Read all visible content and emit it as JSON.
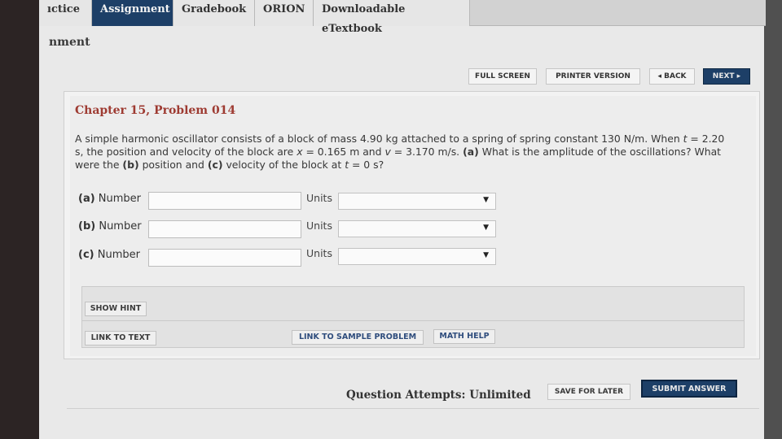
{
  "tabs": [
    {
      "label": "ıctice"
    },
    {
      "label": "Assignment"
    },
    {
      "label": "Gradebook"
    },
    {
      "label": "ORION"
    },
    {
      "label": "Downloadable eTextbook"
    }
  ],
  "section_title": "nment",
  "toolbar": {
    "full_screen": "FULL SCREEN",
    "printer_version": "PRINTER VERSION",
    "back": "◂ BACK",
    "next": "NEXT ▸"
  },
  "problem": {
    "title": "Chapter 15, Problem 014",
    "text_1": "A simple harmonic oscillator consists of a block of mass 4.90 kg attached to a spring of spring constant 130 N/m. When ",
    "text_t": "t",
    "text_2": " = 2.20 s, the position and velocity of the block are ",
    "text_x": "x",
    "text_3": " = 0.165 m and ",
    "text_v": "v",
    "text_4": " = 3.170 m/s. ",
    "part_a": "(a)",
    "text_5": " What is the amplitude of the oscillations? What were the ",
    "part_b": "(b)",
    "text_6": " position and ",
    "part_c": "(c)",
    "text_7": " velocity of the block at ",
    "text_t2": "t",
    "text_8": " = 0 s?"
  },
  "rows": [
    {
      "part": "(a)",
      "label": "Number",
      "units_label": "Units",
      "value": "",
      "unit_selected": ""
    },
    {
      "part": "(b)",
      "label": "Number",
      "units_label": "Units",
      "value": "",
      "unit_selected": ""
    },
    {
      "part": "(c)",
      "label": "Number",
      "units_label": "Units",
      "value": "",
      "unit_selected": ""
    }
  ],
  "hints": {
    "show_hint": "SHOW HINT",
    "link_to_text": "LINK TO TEXT",
    "link_to_sample": "LINK TO SAMPLE PROBLEM",
    "math_help": "MATH HELP"
  },
  "footer": {
    "attempts": "Question Attempts: Unlimited",
    "save_later": "SAVE FOR LATER",
    "submit": "SUBMIT ANSWER"
  },
  "icons": {
    "caret": "caret-down-icon"
  }
}
